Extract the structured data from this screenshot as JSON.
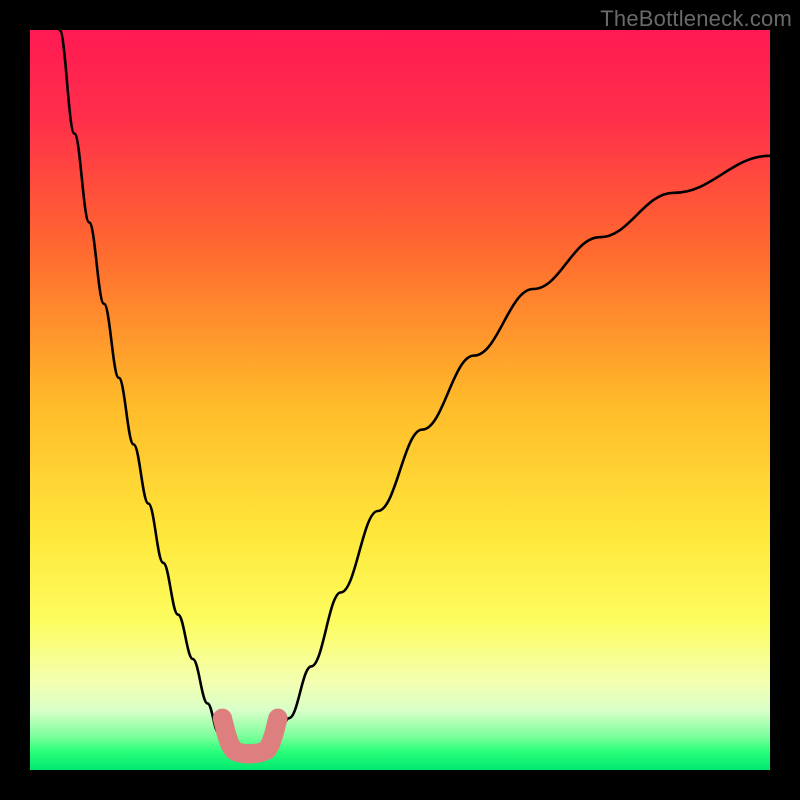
{
  "watermark": "TheBottleneck.com",
  "colors": {
    "frame": "#000000",
    "curve_stroke": "#000000",
    "marker_stroke": "#dd7f7f",
    "gradient_stops": [
      {
        "offset": 0.0,
        "color": "#ff1a53"
      },
      {
        "offset": 0.12,
        "color": "#ff2f4a"
      },
      {
        "offset": 0.3,
        "color": "#ff6a2f"
      },
      {
        "offset": 0.5,
        "color": "#ffb92a"
      },
      {
        "offset": 0.68,
        "color": "#ffe73a"
      },
      {
        "offset": 0.8,
        "color": "#fdfd60"
      },
      {
        "offset": 0.88,
        "color": "#f4ffb0"
      },
      {
        "offset": 0.92,
        "color": "#d8ffc8"
      },
      {
        "offset": 0.955,
        "color": "#7aff9a"
      },
      {
        "offset": 0.975,
        "color": "#2aff7a"
      },
      {
        "offset": 1.0,
        "color": "#00e870"
      }
    ]
  },
  "chart_data": {
    "type": "line",
    "title": "",
    "xlabel": "",
    "ylabel": "",
    "xlim": [
      0,
      100
    ],
    "ylim": [
      0,
      100
    ],
    "series": [
      {
        "name": "bottleneck-curve-left",
        "x": [
          4,
          6,
          8,
          10,
          12,
          14,
          16,
          18,
          20,
          22,
          24,
          25.5,
          27
        ],
        "y": [
          100,
          86,
          74,
          63,
          53,
          44,
          36,
          28,
          21,
          15,
          9,
          5,
          3
        ]
      },
      {
        "name": "bottleneck-curve-right",
        "x": [
          33,
          35,
          38,
          42,
          47,
          53,
          60,
          68,
          77,
          87,
          100
        ],
        "y": [
          3,
          7,
          14,
          24,
          35,
          46,
          56,
          65,
          72,
          78,
          83
        ]
      },
      {
        "name": "highlight-L-marker",
        "x": [
          26,
          26.5,
          27,
          27.5,
          28,
          29,
          30,
          31,
          32,
          32.5,
          33,
          33.5
        ],
        "y": [
          7,
          5,
          3.5,
          2.7,
          2.4,
          2.2,
          2.2,
          2.3,
          2.7,
          3.5,
          5,
          7
        ]
      }
    ],
    "annotations": [
      {
        "text": "TheBottleneck.com",
        "position": "top-right"
      }
    ]
  }
}
